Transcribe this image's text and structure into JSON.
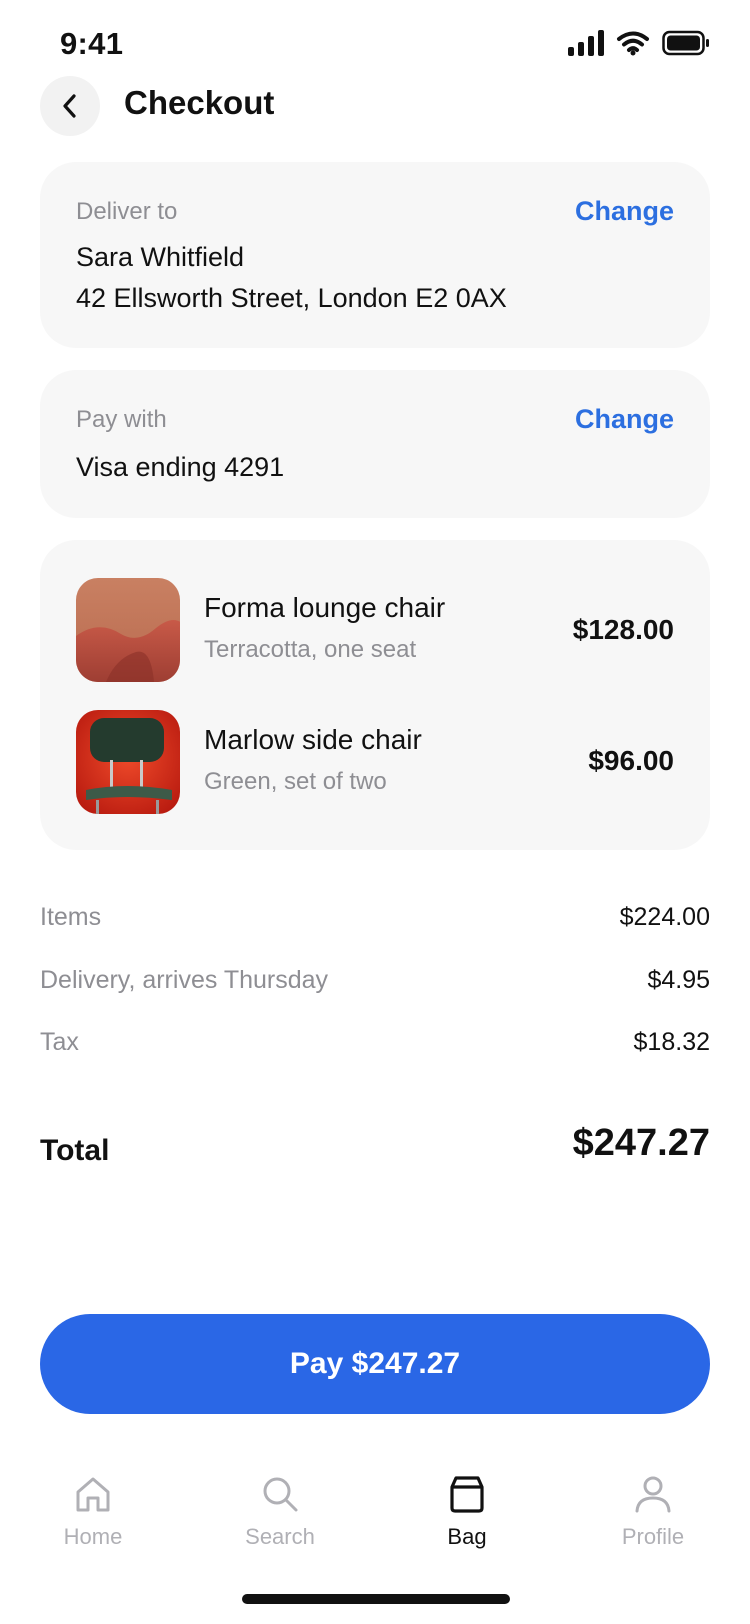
{
  "status_bar": {
    "time": "9:41"
  },
  "header": {
    "title": "Checkout"
  },
  "delivery": {
    "label": "Deliver to",
    "change_label": "Change",
    "name": "Sara Whitfield",
    "address": "42 Ellsworth Street, London E2 0AX"
  },
  "payment": {
    "label": "Pay with",
    "change_label": "Change",
    "method": "Visa ending 4291"
  },
  "items": [
    {
      "name": "Forma lounge chair",
      "variant": "Terracotta, one seat",
      "price": "$128.00",
      "thumbnail": "terracotta-chair-photo"
    },
    {
      "name": "Marlow side chair",
      "variant": "Green, set of two",
      "price": "$96.00",
      "thumbnail": "green-chair-photo"
    }
  ],
  "summary": {
    "rows": [
      {
        "label": "Items",
        "value": "$224.00"
      },
      {
        "label": "Delivery, arrives Thursday",
        "value": "$4.95"
      },
      {
        "label": "Tax",
        "value": "$18.32"
      }
    ],
    "total_label": "Total",
    "total_value": "$247.27"
  },
  "pay_button": {
    "label": "Pay $247.27"
  },
  "tab_bar": {
    "tabs": [
      {
        "label": "Home",
        "icon": "home-icon",
        "active": false
      },
      {
        "label": "Search",
        "icon": "search-icon",
        "active": false
      },
      {
        "label": "Bag",
        "icon": "bag-icon",
        "active": true
      },
      {
        "label": "Profile",
        "icon": "profile-icon",
        "active": false
      }
    ]
  },
  "colors": {
    "accent": "#2a67e6",
    "link": "#2c6fe0",
    "card_bg": "#f7f7f7",
    "muted_text": "#8e8e93"
  }
}
